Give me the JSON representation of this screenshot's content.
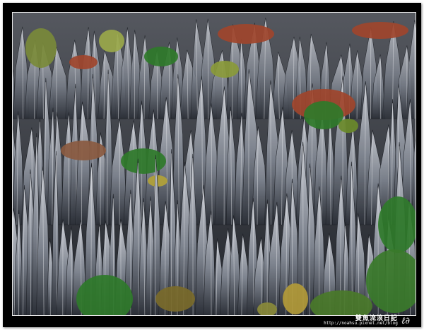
{
  "photo": {
    "subject": "Grey karst limestone pinnacle forest with scattered green and autumn-red shrubs"
  },
  "credit": {
    "title": "雙魚流浪日記",
    "url": "http://noahsu.pixnet.net/blog"
  },
  "colors": {
    "frame": "#000000",
    "rock_light": "#c9ccd3",
    "rock_mid": "#7d838e",
    "rock_dark": "#2c3038",
    "foliage_green": "#2f7a2a",
    "foliage_red": "#a0452c"
  }
}
